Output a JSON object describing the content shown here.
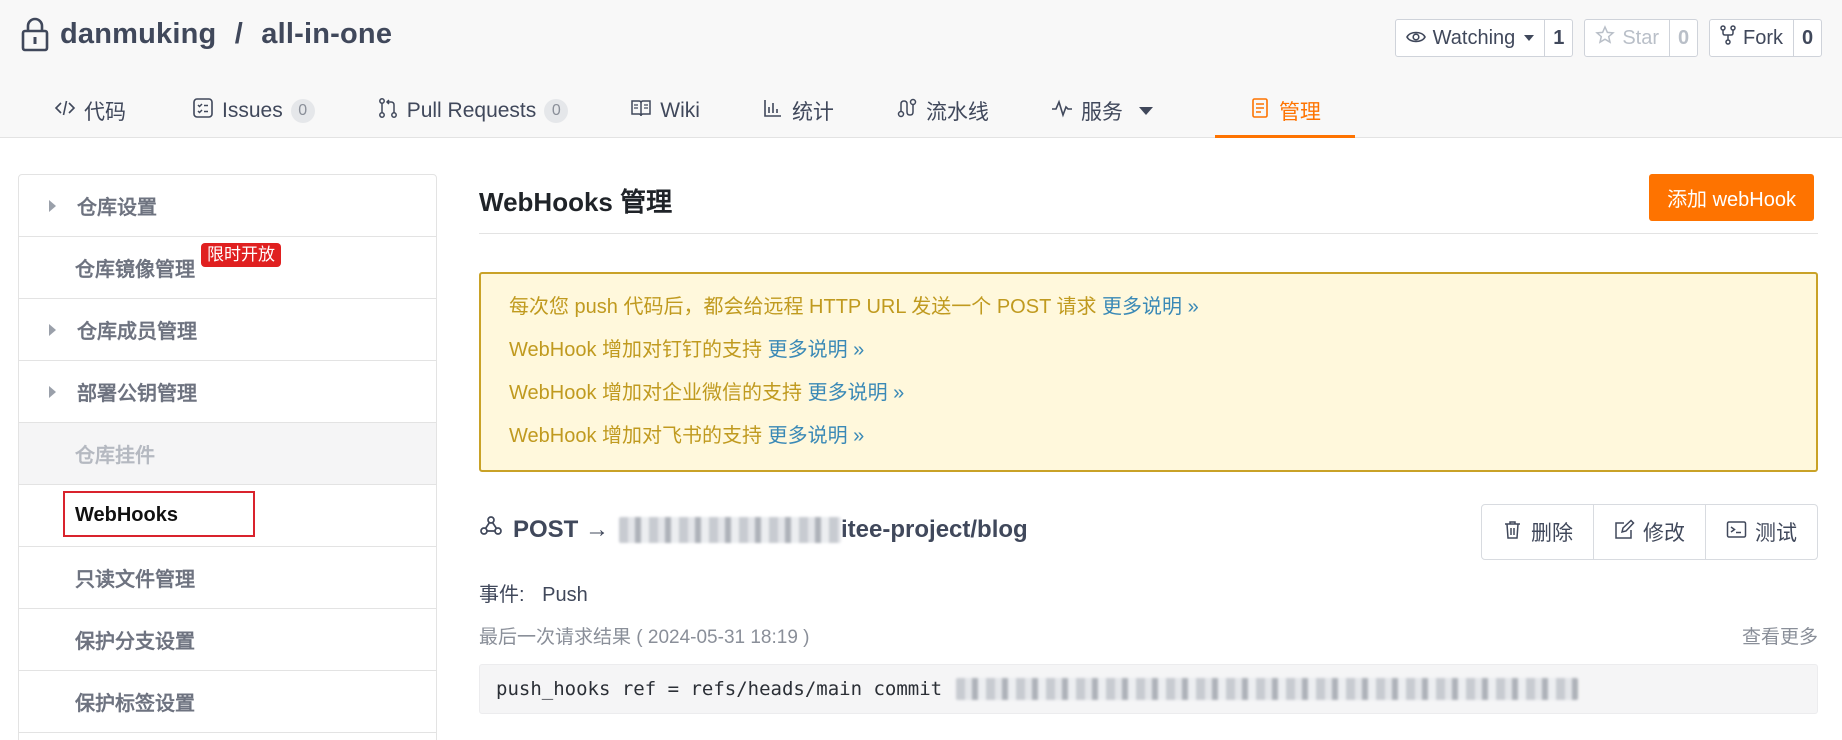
{
  "repo": {
    "owner": "danmuking",
    "separator": " / ",
    "name": "all-in-one"
  },
  "actions": {
    "watch": {
      "label": "Watching",
      "count": "1"
    },
    "star": {
      "label": "Star",
      "count": "0"
    },
    "fork": {
      "label": "Fork",
      "count": "0"
    }
  },
  "tabs": [
    {
      "label": "代码",
      "icon": "code-icon"
    },
    {
      "label": "Issues",
      "icon": "issues-icon",
      "badge": "0"
    },
    {
      "label": "Pull Requests",
      "icon": "pull-request-icon",
      "badge": "0"
    },
    {
      "label": "Wiki",
      "icon": "wiki-icon"
    },
    {
      "label": "统计",
      "icon": "chart-icon"
    },
    {
      "label": "流水线",
      "icon": "pipeline-icon"
    },
    {
      "label": "服务",
      "icon": "pulse-icon"
    },
    {
      "label": "管理",
      "icon": "manage-icon",
      "active": true
    }
  ],
  "sidebar": {
    "items": [
      {
        "label": "仓库设置",
        "type": "parent"
      },
      {
        "label": "仓库镜像管理",
        "badge": "限时开放"
      },
      {
        "label": "仓库成员管理",
        "type": "parent"
      },
      {
        "label": "部署公钥管理",
        "type": "parent"
      },
      {
        "label": "仓库挂件",
        "type": "group"
      },
      {
        "label": "WebHooks",
        "active": true
      },
      {
        "label": "只读文件管理"
      },
      {
        "label": "保护分支设置"
      },
      {
        "label": "保护标签设置"
      }
    ]
  },
  "main": {
    "title": "WebHooks 管理",
    "add_button": "添加 webHook",
    "notices": [
      {
        "text": "每次您 push 代码后，都会给远程 HTTP URL 发送一个 POST 请求 ",
        "link": "更多说明 »"
      },
      {
        "text": "WebHook 增加对钉钉的支持 ",
        "link": "更多说明 »"
      },
      {
        "text": "WebHook 增加对企业微信的支持 ",
        "link": "更多说明 »"
      },
      {
        "text": "WebHook 增加对飞书的支持 ",
        "link": "更多说明 »"
      }
    ],
    "hook": {
      "method": "POST →",
      "url_suffix": "itee-project/blog",
      "delete": "删除",
      "edit": "修改",
      "test": "测试",
      "event_label": "事件:",
      "event_value": "Push",
      "last_request": "最后一次请求结果 ( 2024-05-31 18:19 )",
      "see_more": "查看更多",
      "log": "push_hooks ref = refs/heads/main commit"
    }
  },
  "colors": {
    "accent": "#fe7300",
    "notice_bg": "#fff8dc",
    "notice_text": "#c09a1f",
    "link": "#3a89b6",
    "badge_red": "#e02020"
  }
}
